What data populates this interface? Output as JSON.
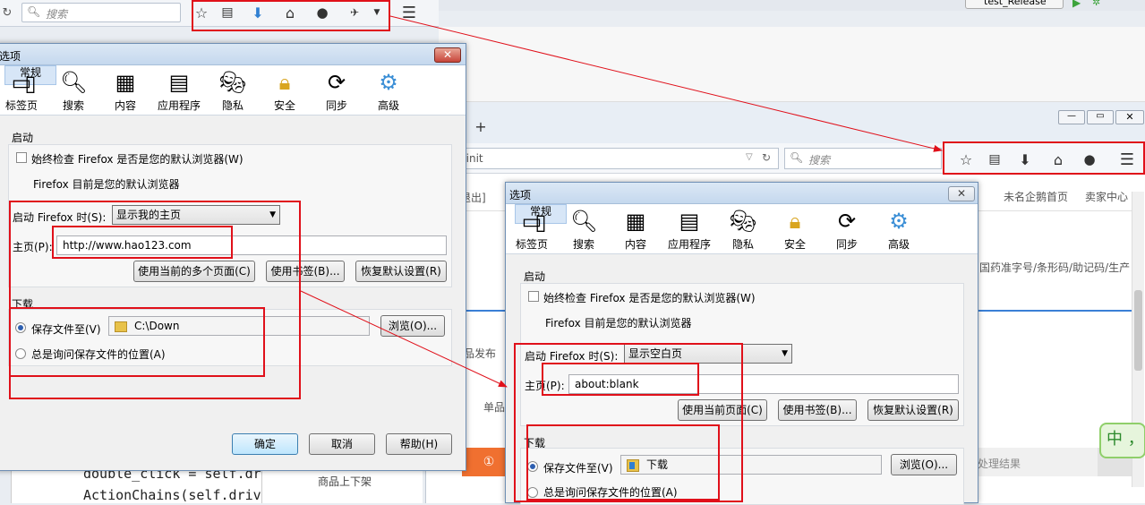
{
  "top_browser": {
    "search_placeholder": "搜索",
    "run_config": "test_Release"
  },
  "right_browser": {
    "url_fragment": "n/init",
    "search_placeholder": "搜索",
    "page_links": {
      "logout": "退出]",
      "home": "未名企鹅首页",
      "seller": "卖家中心"
    },
    "page_texts": {
      "search_hint": "国药准字号/条形码/助记码/生产",
      "publish": "品发布",
      "single": "单品",
      "step_num": "①",
      "result": "处理结果",
      "ime_text": "中 ，"
    }
  },
  "code_editor": {
    "line1": "double_click = self.dr",
    "line2": "ActionChains(self.driv"
  },
  "mid_page": {
    "listing": "商品上下架"
  },
  "left_dialog": {
    "title": "选项",
    "categories": [
      "常规",
      "标签页",
      "搜索",
      "内容",
      "应用程序",
      "隐私",
      "安全",
      "同步",
      "高级"
    ],
    "startup": {
      "group": "启动",
      "check_label": "始终检查 Firefox 是否是您的默认浏览器(W)",
      "default_text": "Firefox 目前是您的默认浏览器",
      "when_label": "启动 Firefox 时(S):",
      "when_value": "显示我的主页",
      "home_label": "主页(P):",
      "home_value": "http://www.hao123.com",
      "btn_current": "使用当前的多个页面(C)",
      "btn_bookmark": "使用书签(B)...",
      "btn_restore": "恢复默认设置(R)"
    },
    "downloads": {
      "group": "下载",
      "save_label": "保存文件至(V)",
      "save_path": "C:\\Down",
      "browse": "浏览(O)...",
      "ask_label": "总是询问保存文件的位置(A)"
    },
    "footer": {
      "ok": "确定",
      "cancel": "取消",
      "help": "帮助(H)"
    }
  },
  "right_dialog": {
    "title": "选项",
    "categories": [
      "常规",
      "标签页",
      "搜索",
      "内容",
      "应用程序",
      "隐私",
      "安全",
      "同步",
      "高级"
    ],
    "startup": {
      "group": "启动",
      "check_label": "始终检查 Firefox 是否是您的默认浏览器(W)",
      "default_text": "Firefox 目前是您的默认浏览器",
      "when_label": "启动 Firefox 时(S):",
      "when_value": "显示空白页",
      "home_label": "主页(P):",
      "home_value": "about:blank",
      "btn_current": "使用当前页面(C)",
      "btn_bookmark": "使用书签(B)...",
      "btn_restore": "恢复默认设置(R)"
    },
    "downloads": {
      "group": "下载",
      "save_label": "保存文件至(V)",
      "save_path": "下载",
      "browse": "浏览(O)...",
      "ask_label": "总是询问保存文件的位置(A)"
    }
  },
  "colors": {
    "annotation": "#e0101a",
    "accent": "#2e5fb0"
  }
}
